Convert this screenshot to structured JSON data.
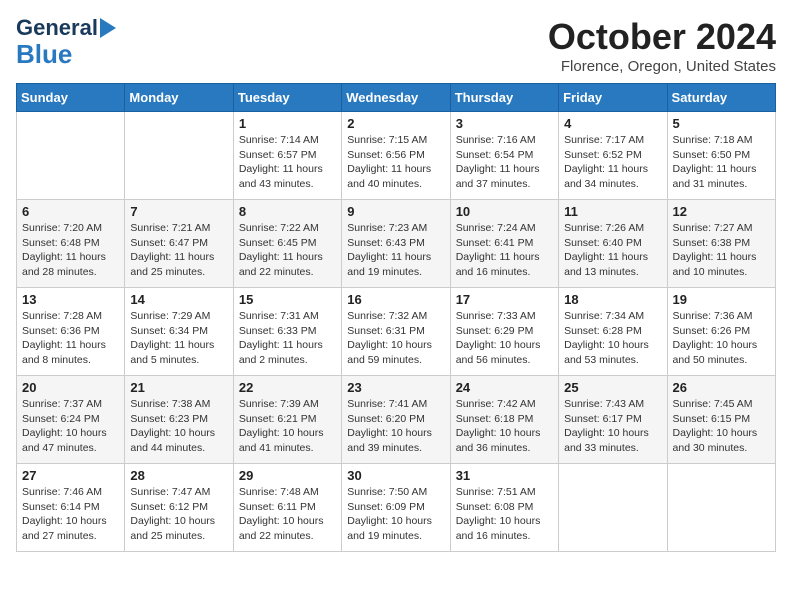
{
  "header": {
    "logo_line1": "General",
    "logo_line2": "Blue",
    "month": "October 2024",
    "location": "Florence, Oregon, United States"
  },
  "days_of_week": [
    "Sunday",
    "Monday",
    "Tuesday",
    "Wednesday",
    "Thursday",
    "Friday",
    "Saturday"
  ],
  "weeks": [
    [
      {
        "day": "",
        "detail": ""
      },
      {
        "day": "",
        "detail": ""
      },
      {
        "day": "1",
        "detail": "Sunrise: 7:14 AM\nSunset: 6:57 PM\nDaylight: 11 hours and 43 minutes."
      },
      {
        "day": "2",
        "detail": "Sunrise: 7:15 AM\nSunset: 6:56 PM\nDaylight: 11 hours and 40 minutes."
      },
      {
        "day": "3",
        "detail": "Sunrise: 7:16 AM\nSunset: 6:54 PM\nDaylight: 11 hours and 37 minutes."
      },
      {
        "day": "4",
        "detail": "Sunrise: 7:17 AM\nSunset: 6:52 PM\nDaylight: 11 hours and 34 minutes."
      },
      {
        "day": "5",
        "detail": "Sunrise: 7:18 AM\nSunset: 6:50 PM\nDaylight: 11 hours and 31 minutes."
      }
    ],
    [
      {
        "day": "6",
        "detail": "Sunrise: 7:20 AM\nSunset: 6:48 PM\nDaylight: 11 hours and 28 minutes."
      },
      {
        "day": "7",
        "detail": "Sunrise: 7:21 AM\nSunset: 6:47 PM\nDaylight: 11 hours and 25 minutes."
      },
      {
        "day": "8",
        "detail": "Sunrise: 7:22 AM\nSunset: 6:45 PM\nDaylight: 11 hours and 22 minutes."
      },
      {
        "day": "9",
        "detail": "Sunrise: 7:23 AM\nSunset: 6:43 PM\nDaylight: 11 hours and 19 minutes."
      },
      {
        "day": "10",
        "detail": "Sunrise: 7:24 AM\nSunset: 6:41 PM\nDaylight: 11 hours and 16 minutes."
      },
      {
        "day": "11",
        "detail": "Sunrise: 7:26 AM\nSunset: 6:40 PM\nDaylight: 11 hours and 13 minutes."
      },
      {
        "day": "12",
        "detail": "Sunrise: 7:27 AM\nSunset: 6:38 PM\nDaylight: 11 hours and 10 minutes."
      }
    ],
    [
      {
        "day": "13",
        "detail": "Sunrise: 7:28 AM\nSunset: 6:36 PM\nDaylight: 11 hours and 8 minutes."
      },
      {
        "day": "14",
        "detail": "Sunrise: 7:29 AM\nSunset: 6:34 PM\nDaylight: 11 hours and 5 minutes."
      },
      {
        "day": "15",
        "detail": "Sunrise: 7:31 AM\nSunset: 6:33 PM\nDaylight: 11 hours and 2 minutes."
      },
      {
        "day": "16",
        "detail": "Sunrise: 7:32 AM\nSunset: 6:31 PM\nDaylight: 10 hours and 59 minutes."
      },
      {
        "day": "17",
        "detail": "Sunrise: 7:33 AM\nSunset: 6:29 PM\nDaylight: 10 hours and 56 minutes."
      },
      {
        "day": "18",
        "detail": "Sunrise: 7:34 AM\nSunset: 6:28 PM\nDaylight: 10 hours and 53 minutes."
      },
      {
        "day": "19",
        "detail": "Sunrise: 7:36 AM\nSunset: 6:26 PM\nDaylight: 10 hours and 50 minutes."
      }
    ],
    [
      {
        "day": "20",
        "detail": "Sunrise: 7:37 AM\nSunset: 6:24 PM\nDaylight: 10 hours and 47 minutes."
      },
      {
        "day": "21",
        "detail": "Sunrise: 7:38 AM\nSunset: 6:23 PM\nDaylight: 10 hours and 44 minutes."
      },
      {
        "day": "22",
        "detail": "Sunrise: 7:39 AM\nSunset: 6:21 PM\nDaylight: 10 hours and 41 minutes."
      },
      {
        "day": "23",
        "detail": "Sunrise: 7:41 AM\nSunset: 6:20 PM\nDaylight: 10 hours and 39 minutes."
      },
      {
        "day": "24",
        "detail": "Sunrise: 7:42 AM\nSunset: 6:18 PM\nDaylight: 10 hours and 36 minutes."
      },
      {
        "day": "25",
        "detail": "Sunrise: 7:43 AM\nSunset: 6:17 PM\nDaylight: 10 hours and 33 minutes."
      },
      {
        "day": "26",
        "detail": "Sunrise: 7:45 AM\nSunset: 6:15 PM\nDaylight: 10 hours and 30 minutes."
      }
    ],
    [
      {
        "day": "27",
        "detail": "Sunrise: 7:46 AM\nSunset: 6:14 PM\nDaylight: 10 hours and 27 minutes."
      },
      {
        "day": "28",
        "detail": "Sunrise: 7:47 AM\nSunset: 6:12 PM\nDaylight: 10 hours and 25 minutes."
      },
      {
        "day": "29",
        "detail": "Sunrise: 7:48 AM\nSunset: 6:11 PM\nDaylight: 10 hours and 22 minutes."
      },
      {
        "day": "30",
        "detail": "Sunrise: 7:50 AM\nSunset: 6:09 PM\nDaylight: 10 hours and 19 minutes."
      },
      {
        "day": "31",
        "detail": "Sunrise: 7:51 AM\nSunset: 6:08 PM\nDaylight: 10 hours and 16 minutes."
      },
      {
        "day": "",
        "detail": ""
      },
      {
        "day": "",
        "detail": ""
      }
    ]
  ]
}
